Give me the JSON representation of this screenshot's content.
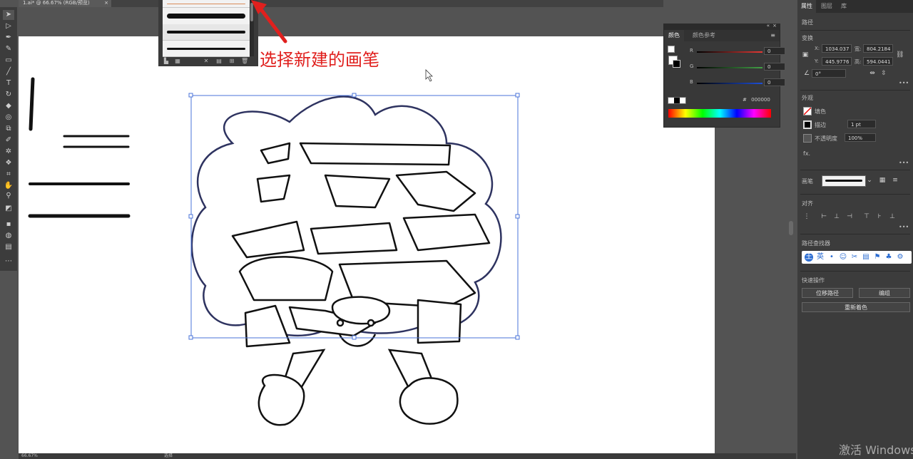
{
  "document_tab": {
    "title": "1.ai* @ 66.67% (RGB/预览)",
    "close": "×"
  },
  "annotation": {
    "text": "选择新建的画笔"
  },
  "brush_panel": {
    "footer_icons": [
      "brush-library-icon",
      "library-menu-icon",
      "remove-stroke-icon",
      "brush-options-icon",
      "new-brush-icon",
      "delete-brush-icon"
    ]
  },
  "color_panel": {
    "tabs": [
      "颜色",
      "颜色参考"
    ],
    "channels": [
      {
        "name": "R",
        "value": "0",
        "color": "#e53935"
      },
      {
        "name": "G",
        "value": "0",
        "color": "#43a047"
      },
      {
        "name": "B",
        "value": "0",
        "color": "#1e4fd8"
      }
    ],
    "hex_prefix": "#",
    "hex_value": "000000"
  },
  "properties": {
    "tabs": [
      "属性",
      "图层",
      "库"
    ],
    "selection_label": "路径",
    "transform_title": "变换",
    "x_label": "X:",
    "x_value": "1034.037",
    "y_label": "Y:",
    "y_value": "445.9776",
    "w_label": "宽:",
    "w_value": "804.2184",
    "h_label": "高:",
    "h_value": "594.0441",
    "angle_value": "0°",
    "appearance_title": "外观",
    "fill_label": "填色",
    "stroke_label": "描边",
    "stroke_value": "1 pt",
    "opacity_label": "不透明度",
    "opacity_value": "100%",
    "fx_label": "fx.",
    "brush_label": "画笔",
    "align_title": "对齐",
    "pathfinder_title": "路径查找器",
    "quick_actions_title": "快速操作",
    "offset_path_btn": "位移路径",
    "edit_btn": "编组",
    "recolor_btn": "重新着色",
    "more": "•••"
  },
  "ime_toolbar": {
    "logo": "王",
    "mode": "英"
  },
  "status_bar": {
    "zoom": "66.67%",
    "tool": "选择"
  },
  "watermark": "激活 Windows"
}
